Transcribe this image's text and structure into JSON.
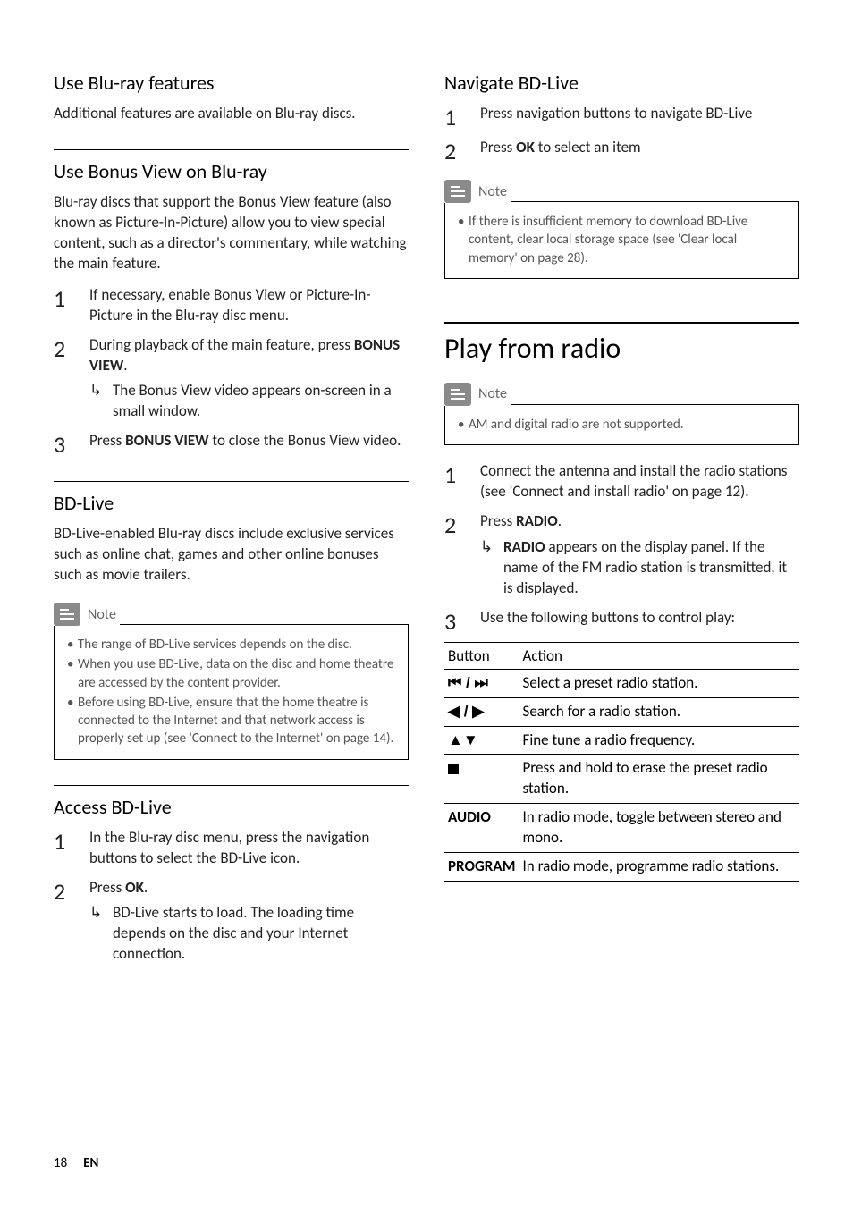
{
  "left": {
    "s1": {
      "heading": "Use Blu-ray features",
      "body": "Additional features are available on Blu-ray discs."
    },
    "s2": {
      "heading": "Use Bonus View on Blu-ray",
      "body": "Blu-ray discs that support the Bonus View feature (also known as Picture-In-Picture) allow you to view special content, such as a director's commentary, while watching the main feature.",
      "step1": "If necessary, enable Bonus View or Picture-In-Picture in the Blu-ray disc menu.",
      "step2a": "During playback of the main feature, press ",
      "step2b": "BONUS VIEW",
      "step2c": ".",
      "step2sub": "The Bonus View video appears on-screen in a small window.",
      "step3a": "Press ",
      "step3b": "BONUS VIEW",
      "step3c": " to close the Bonus View video."
    },
    "s3": {
      "heading": "BD-Live",
      "body": "BD-Live-enabled Blu-ray discs include exclusive services such as online chat, games and other online bonuses such as movie trailers.",
      "note_label": "Note",
      "note_items": [
        "The range of BD-Live services depends on the disc.",
        "When you use BD-Live, data on the disc and home theatre are accessed by the content provider.",
        "Before using BD-Live, ensure that the home theatre is connected to the Internet and that network access is properly set up (see 'Connect to the Internet' on page 14)."
      ]
    },
    "s4": {
      "heading": "Access BD-Live",
      "step1": "In the Blu-ray disc menu, press the navigation buttons to select the BD-Live icon.",
      "step2a": "Press ",
      "step2b": "OK",
      "step2c": ".",
      "step2sub": "BD-Live starts to load. The loading time depends on the disc and your Internet connection."
    }
  },
  "right": {
    "s1": {
      "heading": "Navigate BD-Live",
      "step1": "Press navigation buttons to navigate BD-Live",
      "step2a": "Press ",
      "step2b": "OK",
      "step2c": " to select an item",
      "note_label": "Note",
      "note_items": [
        "If there is insufficient memory to download BD-Live content, clear local storage space (see 'Clear local memory' on page 28)."
      ]
    },
    "s2": {
      "heading": "Play from radio",
      "note_label": "Note",
      "note_items": [
        "AM and digital radio are not supported."
      ],
      "step1": "Connect the antenna and install the radio stations (see 'Connect and install radio' on page 12).",
      "step2a": "Press ",
      "step2b": "RADIO",
      "step2c": ".",
      "step2sub_a": "RADIO",
      "step2sub_b": " appears on the display panel. If the name of the FM radio station is transmitted, it is displayed.",
      "step3": "Use the following buttons to control play:",
      "table": {
        "h1": "Button",
        "h2": "Action",
        "rows": [
          {
            "btn": "⏮ / ⏭",
            "act": "Select a preset radio station."
          },
          {
            "btn": "◀ / ▶",
            "act": "Search for a radio station."
          },
          {
            "btn": "▲▼",
            "act": "Fine tune a radio frequency."
          },
          {
            "btn": "■",
            "act": "Press and hold to erase the preset radio station."
          },
          {
            "btn": "AUDIO",
            "act": "In radio mode, toggle between stereo and mono."
          },
          {
            "btn": "PROGRAM",
            "act": "In radio mode, programme radio stations."
          }
        ]
      }
    }
  },
  "footer": {
    "page": "18",
    "lang": "EN"
  }
}
